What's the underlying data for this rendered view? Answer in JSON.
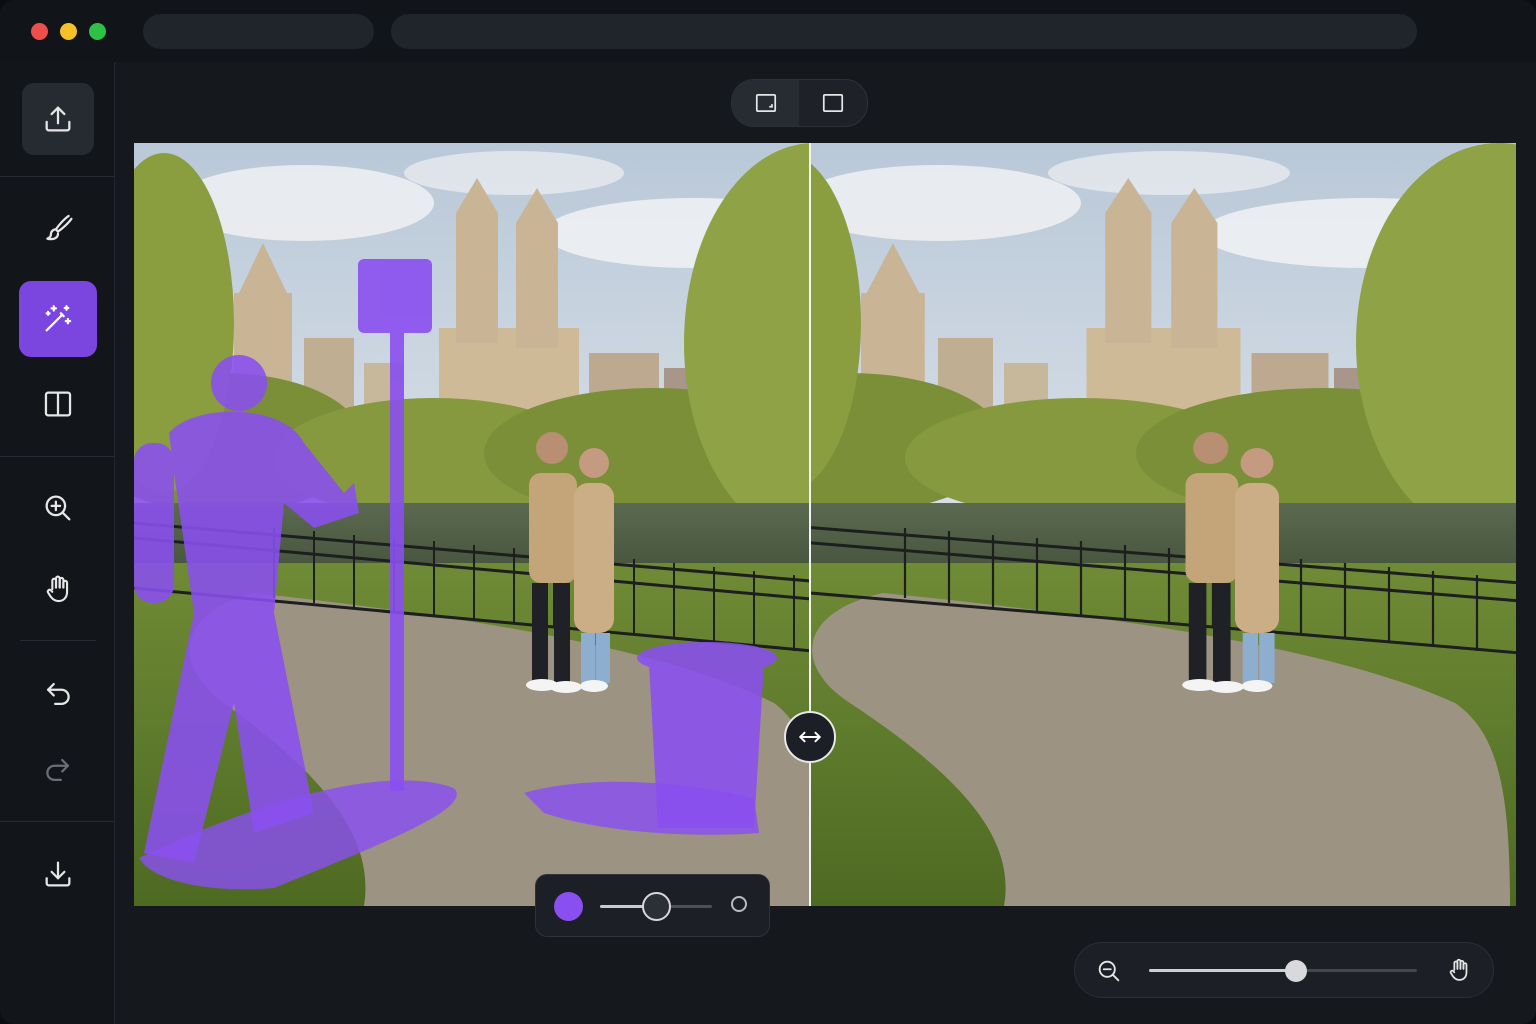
{
  "window": {
    "traffic_lights": [
      "#ee4f4b",
      "#f5c028",
      "#2cc245"
    ],
    "tabs": [
      "",
      ""
    ]
  },
  "sidebar": {
    "tools": [
      {
        "name": "upload-icon",
        "active": false,
        "highlight": true
      },
      {
        "name": "brush-icon",
        "active": false
      },
      {
        "name": "magic-wand-icon",
        "active": true
      },
      {
        "name": "split-view-icon",
        "active": false
      },
      {
        "name": "zoom-in-icon",
        "active": false
      },
      {
        "name": "hand-icon",
        "active": false
      },
      {
        "name": "undo-icon",
        "active": false
      },
      {
        "name": "redo-icon",
        "active": false,
        "disabled": true
      },
      {
        "name": "download-icon",
        "active": false
      }
    ]
  },
  "view_toggle": {
    "options": [
      "compare-view-icon",
      "single-view-icon"
    ],
    "selected": "compare-view-icon"
  },
  "compare": {
    "split_position": 0.49
  },
  "brush": {
    "color": "#8a4ff0",
    "size_level": 0.5
  },
  "zoom": {
    "level": 0.55
  },
  "colors": {
    "accent": "#7b46e0",
    "mask": "#8a4ff0"
  }
}
